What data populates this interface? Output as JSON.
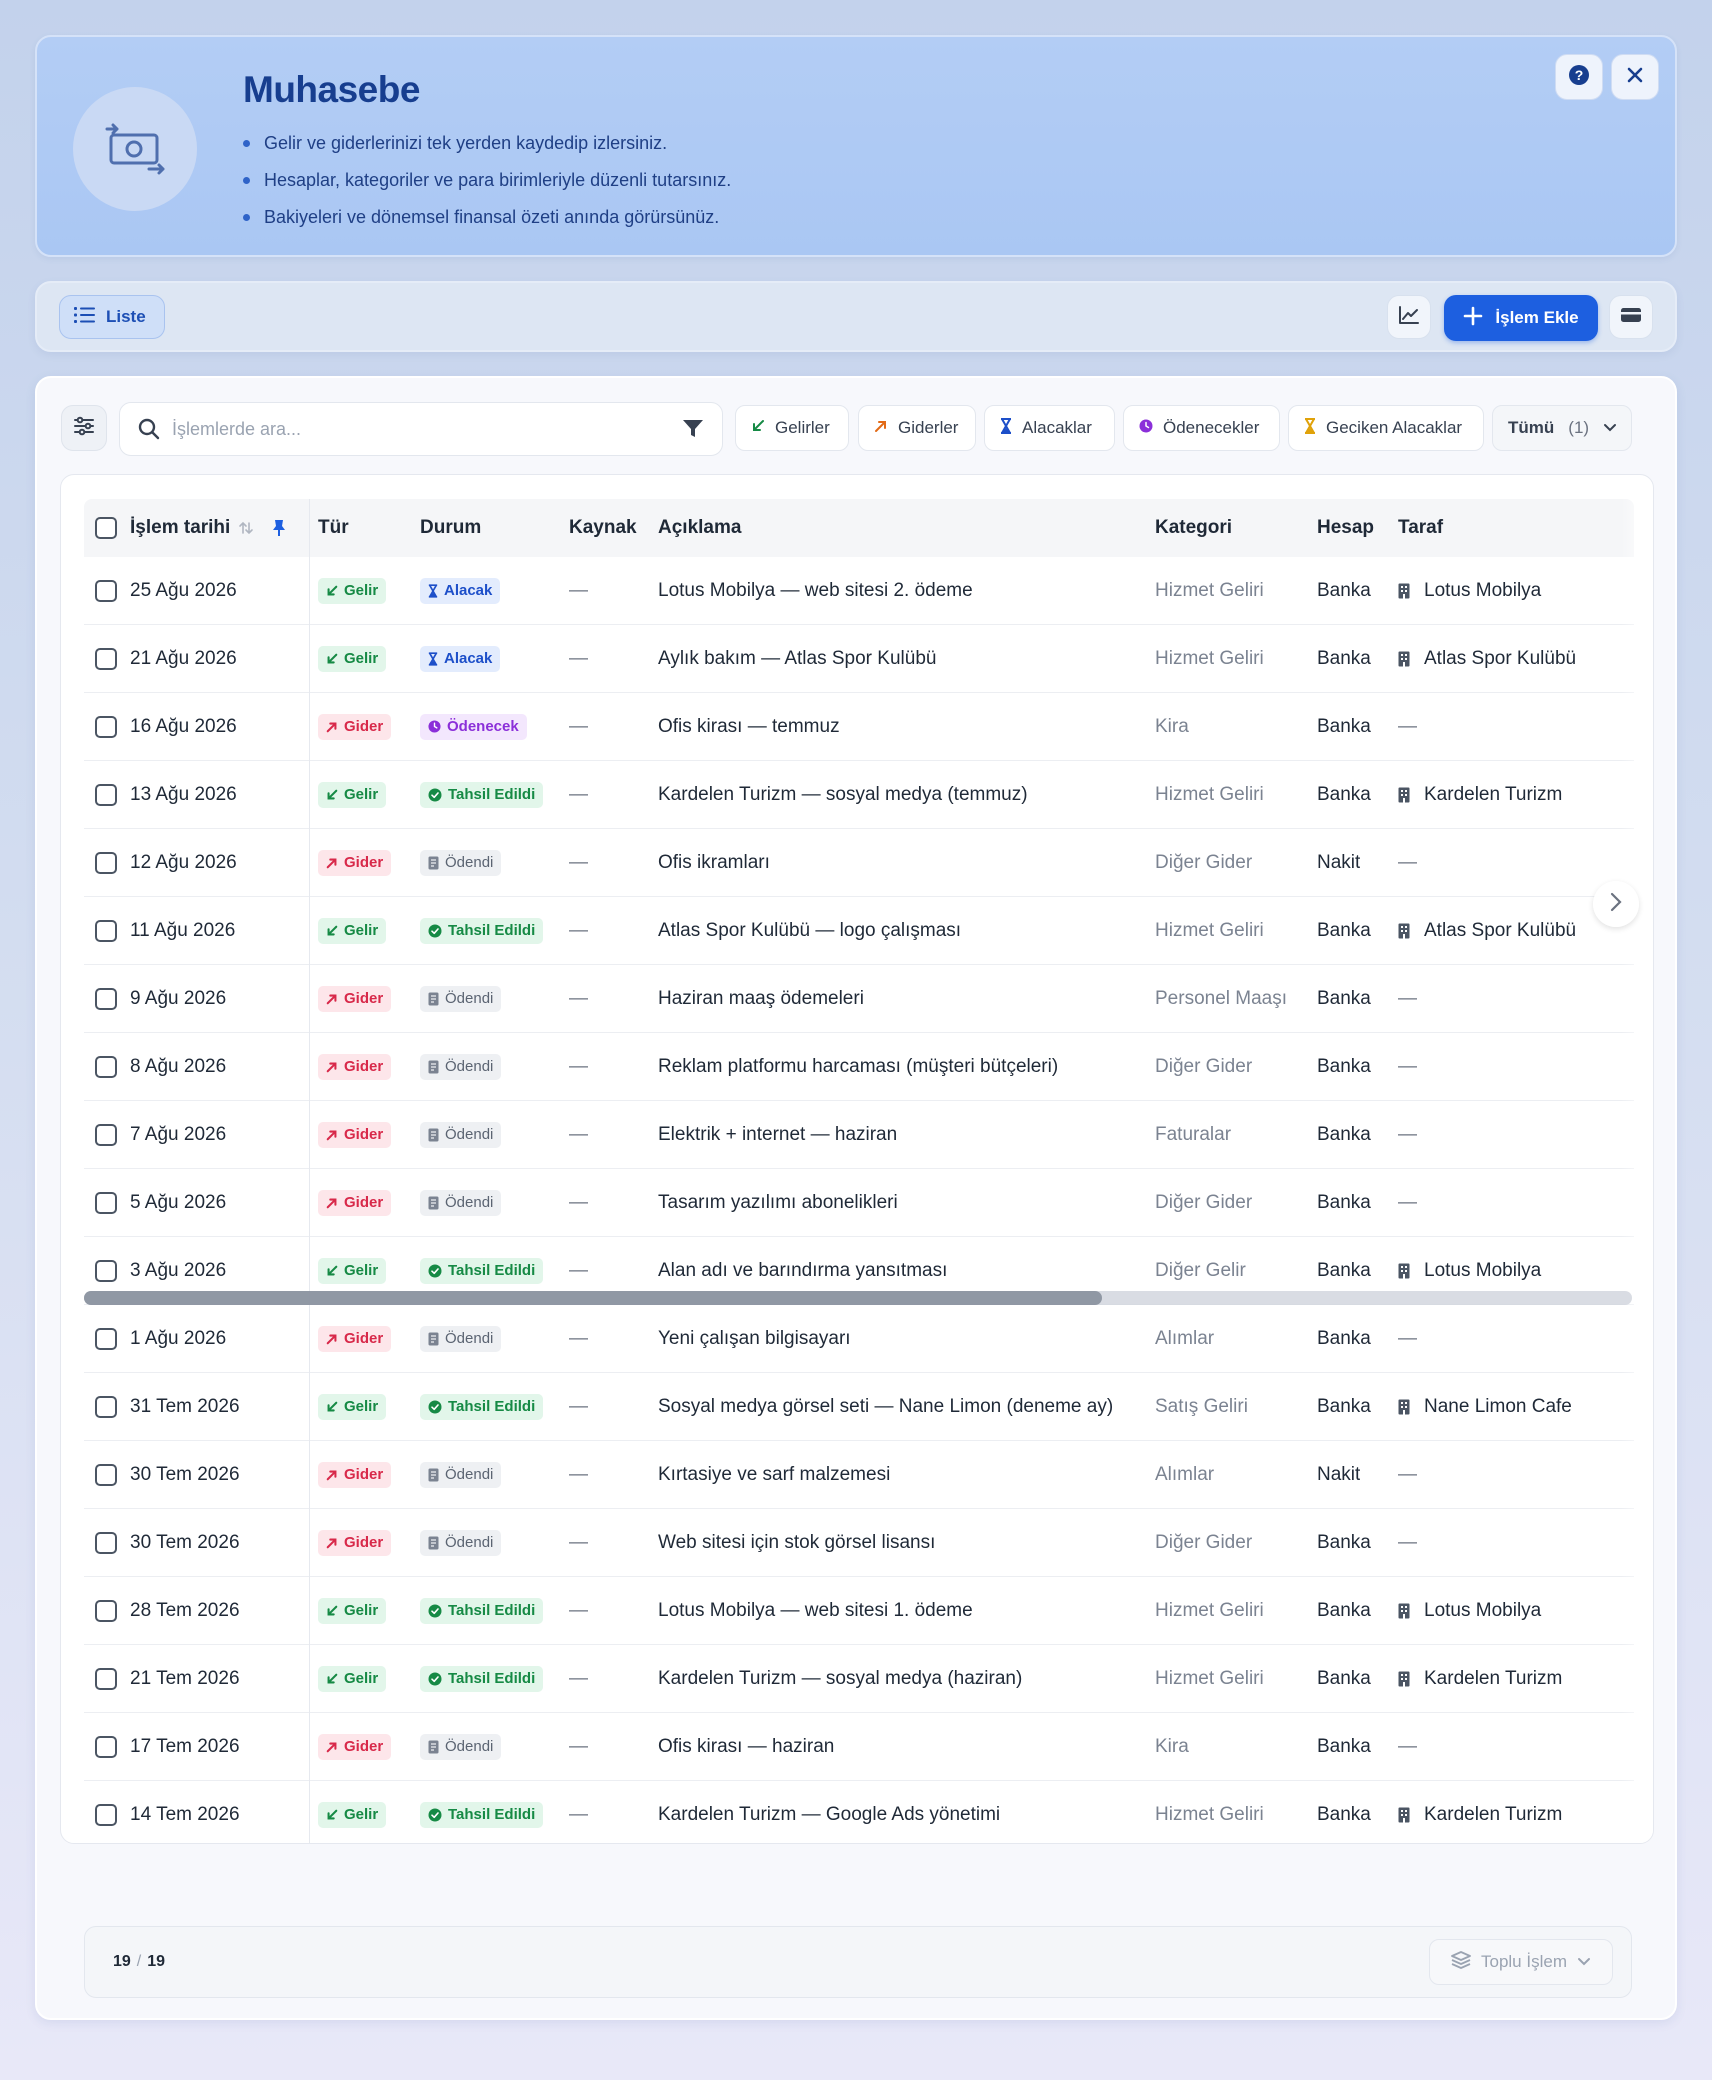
{
  "hero": {
    "title": "Muhasebe",
    "bullets": [
      "Gelir ve giderlerinizi tek yerden kaydedip izlersiniz.",
      "Hesaplar, kategoriler ve para birimleriyle düzenli tutarsınız.",
      "Bakiyeleri ve dönemsel finansal özeti anında görürsünüz."
    ],
    "icons": {
      "avatar": "money-exchange-icon",
      "help": "question-circle-icon",
      "close": "close-icon"
    }
  },
  "toolbar": {
    "view_label": "Liste",
    "add_label": "İşlem Ekle",
    "icons": {
      "view": "list-icon",
      "chart": "line-chart-icon",
      "add": "plus-icon",
      "wallet": "wallet-icon"
    }
  },
  "search": {
    "placeholder": "İşlemlerde ara..."
  },
  "chips": [
    {
      "label": "Gelirler",
      "icon": "arrow-down-left-icon"
    },
    {
      "label": "Giderler",
      "icon": "arrow-up-right-icon"
    },
    {
      "label": "Alacaklar",
      "icon": "hourglass-icon"
    },
    {
      "label": "Ödenecekler",
      "icon": "clock-icon"
    },
    {
      "label": "Geciken Alacaklar",
      "icon": "hourglass-icon"
    }
  ],
  "all_filter": {
    "label": "Tümü",
    "count": "(1)"
  },
  "table": {
    "columns": [
      "İşlem tarihi",
      "Tür",
      "Durum",
      "Kaynak",
      "Açıklama",
      "Kategori",
      "Hesap",
      "Taraf"
    ],
    "rows": [
      {
        "date": "25 Ağu 2026",
        "type": "Gelir",
        "status": "Alacak",
        "source": "—",
        "desc": "Lotus Mobilya — web sitesi 2. ödeme",
        "category": "Hizmet Geliri",
        "account": "Banka",
        "party": "Lotus Mobilya"
      },
      {
        "date": "21 Ağu 2026",
        "type": "Gelir",
        "status": "Alacak",
        "source": "—",
        "desc": "Aylık bakım — Atlas Spor Kulübü",
        "category": "Hizmet Geliri",
        "account": "Banka",
        "party": "Atlas Spor Kulübü"
      },
      {
        "date": "16 Ağu 2026",
        "type": "Gider",
        "status": "Ödenecek",
        "source": "—",
        "desc": "Ofis kirası — temmuz",
        "category": "Kira",
        "account": "Banka",
        "party": "—"
      },
      {
        "date": "13 Ağu 2026",
        "type": "Gelir",
        "status": "Tahsil Edildi",
        "source": "—",
        "desc": "Kardelen Turizm — sosyal medya (temmuz)",
        "category": "Hizmet Geliri",
        "account": "Banka",
        "party": "Kardelen Turizm"
      },
      {
        "date": "12 Ağu 2026",
        "type": "Gider",
        "status": "Ödendi",
        "source": "—",
        "desc": "Ofis ikramları",
        "category": "Diğer Gider",
        "account": "Nakit",
        "party": "—"
      },
      {
        "date": "11 Ağu 2026",
        "type": "Gelir",
        "status": "Tahsil Edildi",
        "source": "—",
        "desc": "Atlas Spor Kulübü — logo çalışması",
        "category": "Hizmet Geliri",
        "account": "Banka",
        "party": "Atlas Spor Kulübü"
      },
      {
        "date": "9 Ağu 2026",
        "type": "Gider",
        "status": "Ödendi",
        "source": "—",
        "desc": "Haziran maaş ödemeleri",
        "category": "Personel Maaşı",
        "account": "Banka",
        "party": "—"
      },
      {
        "date": "8 Ağu 2026",
        "type": "Gider",
        "status": "Ödendi",
        "source": "—",
        "desc": "Reklam platformu harcaması (müşteri bütçeleri)",
        "category": "Diğer Gider",
        "account": "Banka",
        "party": "—"
      },
      {
        "date": "7 Ağu 2026",
        "type": "Gider",
        "status": "Ödendi",
        "source": "—",
        "desc": "Elektrik + internet — haziran",
        "category": "Faturalar",
        "account": "Banka",
        "party": "—"
      },
      {
        "date": "5 Ağu 2026",
        "type": "Gider",
        "status": "Ödendi",
        "source": "—",
        "desc": "Tasarım yazılımı abonelikleri",
        "category": "Diğer Gider",
        "account": "Banka",
        "party": "—"
      },
      {
        "date": "3 Ağu 2026",
        "type": "Gelir",
        "status": "Tahsil Edildi",
        "source": "—",
        "desc": "Alan adı ve barındırma yansıtması",
        "category": "Diğer Gelir",
        "account": "Banka",
        "party": "Lotus Mobilya"
      },
      {
        "date": "1 Ağu 2026",
        "type": "Gider",
        "status": "Ödendi",
        "source": "—",
        "desc": "Yeni çalışan bilgisayarı",
        "category": "Alımlar",
        "account": "Banka",
        "party": "—"
      },
      {
        "date": "31 Tem 2026",
        "type": "Gelir",
        "status": "Tahsil Edildi",
        "source": "—",
        "desc": "Sosyal medya görsel seti — Nane Limon (deneme ay)",
        "category": "Satış Geliri",
        "account": "Banka",
        "party": "Nane Limon Cafe"
      },
      {
        "date": "30 Tem 2026",
        "type": "Gider",
        "status": "Ödendi",
        "source": "—",
        "desc": "Kırtasiye ve sarf malzemesi",
        "category": "Alımlar",
        "account": "Nakit",
        "party": "—"
      },
      {
        "date": "30 Tem 2026",
        "type": "Gider",
        "status": "Ödendi",
        "source": "—",
        "desc": "Web sitesi için stok görsel lisansı",
        "category": "Diğer Gider",
        "account": "Banka",
        "party": "—"
      },
      {
        "date": "28 Tem 2026",
        "type": "Gelir",
        "status": "Tahsil Edildi",
        "source": "—",
        "desc": "Lotus Mobilya — web sitesi 1. ödeme",
        "category": "Hizmet Geliri",
        "account": "Banka",
        "party": "Lotus Mobilya"
      },
      {
        "date": "21 Tem 2026",
        "type": "Gelir",
        "status": "Tahsil Edildi",
        "source": "—",
        "desc": "Kardelen Turizm — sosyal medya (haziran)",
        "category": "Hizmet Geliri",
        "account": "Banka",
        "party": "Kardelen Turizm"
      },
      {
        "date": "17 Tem 2026",
        "type": "Gider",
        "status": "Ödendi",
        "source": "—",
        "desc": "Ofis kirası — haziran",
        "category": "Kira",
        "account": "Banka",
        "party": "—"
      },
      {
        "date": "14 Tem 2026",
        "type": "Gelir",
        "status": "Tahsil Edildi",
        "source": "—",
        "desc": "Kardelen Turizm — Google Ads yönetimi",
        "category": "Hizmet Geliri",
        "account": "Banka",
        "party": "Kardelen Turizm"
      }
    ]
  },
  "footer": {
    "shown": "19",
    "separator": "/",
    "total": "19",
    "bulk_label": "Toplu İşlem"
  },
  "colors": {
    "accent": "#1d5fe0",
    "gelir": "#168a45",
    "gider": "#d8294a",
    "alacak": "#1d4fc9",
    "odenecek": "#8b2fd9"
  }
}
